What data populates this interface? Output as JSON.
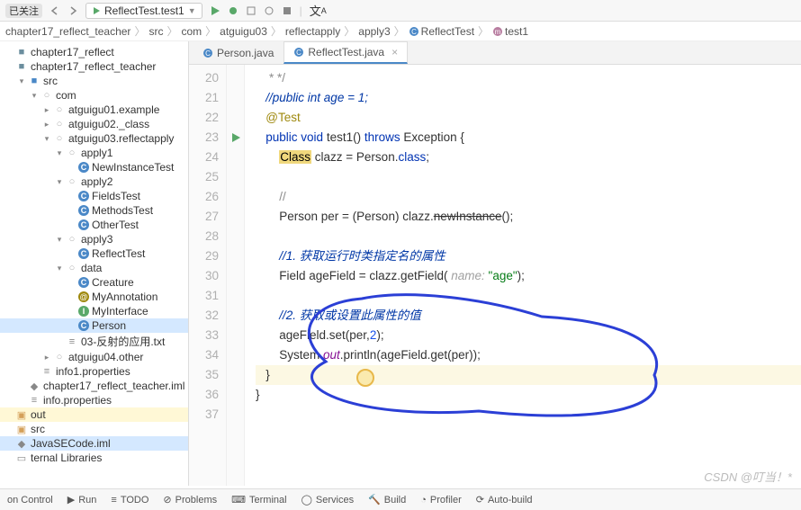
{
  "toolbar": {
    "run_config": "ReflectTest.test1",
    "badge": "已关注"
  },
  "breadcrumb": [
    "chapter17_reflect_teacher",
    "src",
    "com",
    "atguigu03",
    "reflectapply",
    "apply3",
    "ReflectTest",
    "test1"
  ],
  "tabs": [
    {
      "label": "Person.java",
      "active": false
    },
    {
      "label": "ReflectTest.java",
      "active": true
    }
  ],
  "tree": [
    {
      "l": "chapter17_reflect",
      "d": 0,
      "i": "mod",
      "t": ""
    },
    {
      "l": "chapter17_reflect_teacher",
      "d": 0,
      "i": "mod",
      "t": ""
    },
    {
      "l": "src",
      "d": 1,
      "i": "src",
      "t": "v"
    },
    {
      "l": "com",
      "d": 2,
      "i": "pkg",
      "t": "v"
    },
    {
      "l": "atguigu01.example",
      "d": 3,
      "i": "pkg",
      "t": ">"
    },
    {
      "l": "atguigu02._class",
      "d": 3,
      "i": "pkg",
      "t": ">"
    },
    {
      "l": "atguigu03.reflectapply",
      "d": 3,
      "i": "pkg",
      "t": "v"
    },
    {
      "l": "apply1",
      "d": 4,
      "i": "pkg",
      "t": "v"
    },
    {
      "l": "NewInstanceTest",
      "d": 5,
      "i": "cls",
      "t": ""
    },
    {
      "l": "apply2",
      "d": 4,
      "i": "pkg",
      "t": "v"
    },
    {
      "l": "FieldsTest",
      "d": 5,
      "i": "cls",
      "t": ""
    },
    {
      "l": "MethodsTest",
      "d": 5,
      "i": "cls",
      "t": ""
    },
    {
      "l": "OtherTest",
      "d": 5,
      "i": "cls",
      "t": ""
    },
    {
      "l": "apply3",
      "d": 4,
      "i": "pkg",
      "t": "v"
    },
    {
      "l": "ReflectTest",
      "d": 5,
      "i": "cls",
      "t": ""
    },
    {
      "l": "data",
      "d": 4,
      "i": "pkg",
      "t": "v"
    },
    {
      "l": "Creature",
      "d": 5,
      "i": "cls",
      "t": ""
    },
    {
      "l": "MyAnnotation",
      "d": 5,
      "i": "ann",
      "t": ""
    },
    {
      "l": "MyInterface",
      "d": 5,
      "i": "int",
      "t": ""
    },
    {
      "l": "Person",
      "d": 5,
      "i": "cls",
      "t": "",
      "sel": true
    },
    {
      "l": "03-反射的应用.txt",
      "d": 4,
      "i": "txt",
      "t": ""
    },
    {
      "l": "atguigu04.other",
      "d": 3,
      "i": "pkg",
      "t": ">"
    },
    {
      "l": "info1.properties",
      "d": 2,
      "i": "prop",
      "t": ""
    },
    {
      "l": "chapter17_reflect_teacher.iml",
      "d": 1,
      "i": "iml",
      "t": ""
    },
    {
      "l": "info.properties",
      "d": 1,
      "i": "prop",
      "t": ""
    },
    {
      "l": "out",
      "d": 0,
      "i": "dir",
      "t": "",
      "hl": true
    },
    {
      "l": "src",
      "d": 0,
      "i": "dir",
      "t": ""
    },
    {
      "l": "JavaSECode.iml",
      "d": 0,
      "i": "iml",
      "t": "",
      "sel": true
    },
    {
      "l": "ternal Libraries",
      "d": 0,
      "i": "lib",
      "t": ""
    }
  ],
  "code": {
    "start": 20,
    "lines": [
      {
        "h": " * */",
        "cls": "com"
      },
      {
        "h": "//public int age = 1;",
        "cls": "comblue"
      },
      {
        "h": "@Test",
        "cls": "ann"
      },
      {
        "raw": "<span class='kw'>public void</span> test1() <span class='kw'>throws</span> Exception {"
      },
      {
        "raw": "    <span class='cls'>Class</span> clazz = Person.<span class='kw'>class</span>;"
      },
      {
        "h": ""
      },
      {
        "h": "    //",
        "cls": "com"
      },
      {
        "raw": "    Person per = (Person) clazz.<span class='strike'>newInstance</span>();"
      },
      {
        "h": ""
      },
      {
        "raw": "    <span class='comblue'>//1. 获取运行时类指定名的属性</span>"
      },
      {
        "raw": "    Field ageField = clazz.getField( <span class='hint'>name:</span> <span class='str'>\"age\"</span>);"
      },
      {
        "h": ""
      },
      {
        "raw": "    <span class='comblue'>//2. 获取或设置此属性的值</span>"
      },
      {
        "raw": "    ageField.set(per,<span class='num'>2</span>);"
      },
      {
        "raw": "    System.<span class='fld'>out</span>.println(ageField.get(per));"
      },
      {
        "h": "}",
        "hl": true
      },
      {
        "h": "}",
        "ind": -1
      },
      {
        "h": ""
      }
    ]
  },
  "bottom": [
    "on Control",
    "Run",
    "TODO",
    "Problems",
    "Terminal",
    "Services",
    "Build",
    "Profiler",
    "Auto-build"
  ],
  "watermark": "CSDN @叮当！*"
}
